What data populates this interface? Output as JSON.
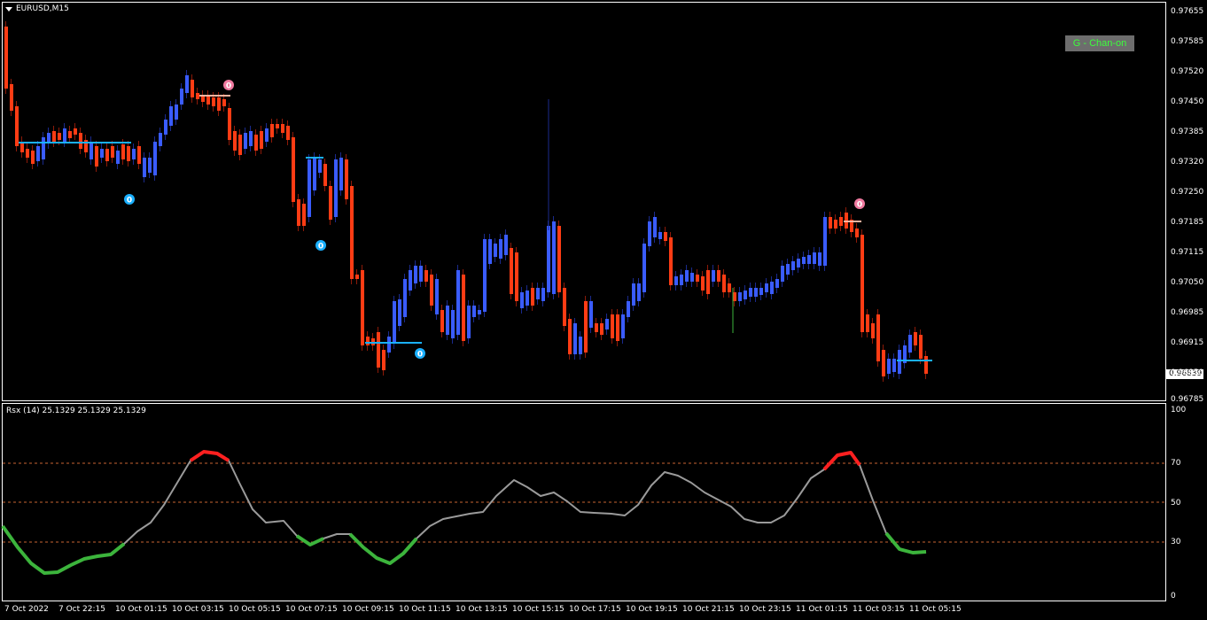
{
  "window": {
    "symbol_title": "EURUSD,M15",
    "indicator_badge": "G - Chan-on",
    "current_price": "0.96839"
  },
  "price_axis": {
    "ticks": [
      "0.97655",
      "0.97585",
      "0.97520",
      "0.97450",
      "0.97385",
      "0.97320",
      "0.97250",
      "0.97185",
      "0.97115",
      "0.97050",
      "0.96985",
      "0.96915",
      "0.96850",
      "0.96785"
    ]
  },
  "rsx_panel": {
    "label": "Rsx (14) 25.1329 25.1329 25.1329",
    "levels": [
      "100",
      "70",
      "50",
      "30",
      "0"
    ]
  },
  "time_axis": {
    "ticks": [
      "7 Oct 2022",
      "7 Oct 22:15",
      "10 Oct 01:15",
      "10 Oct 03:15",
      "10 Oct 05:15",
      "10 Oct 07:15",
      "10 Oct 09:15",
      "10 Oct 11:15",
      "10 Oct 13:15",
      "10 Oct 15:15",
      "10 Oct 17:15",
      "10 Oct 19:15",
      "10 Oct 21:15",
      "10 Oct 23:15",
      "11 Oct 01:15",
      "11 Oct 03:15",
      "11 Oct 05:15"
    ]
  },
  "markers": [
    {
      "text": "0",
      "color": "#f07aa0"
    },
    {
      "text": "0",
      "color": "#1ab0ff"
    },
    {
      "text": "0",
      "color": "#1ab0ff"
    },
    {
      "text": "0",
      "color": "#1ab0ff"
    },
    {
      "text": "0",
      "color": "#f07aa0"
    }
  ],
  "colors": {
    "bull": "#3a5cff",
    "bear": "#ff3c14",
    "level_line": "#1ab0ff",
    "rsx_neutral": "#9a9a9a",
    "rsx_high": "#ff2020",
    "rsx_low": "#3cb43c",
    "grid_dash": "#c86432"
  }
}
